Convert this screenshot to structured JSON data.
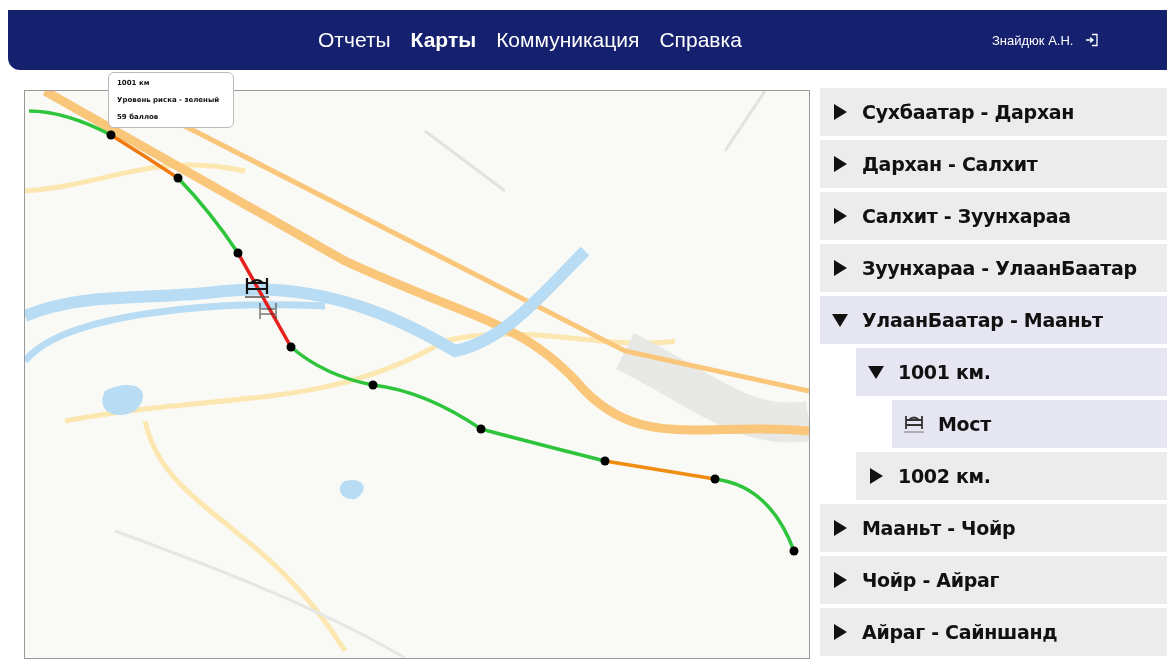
{
  "nav": {
    "items": [
      {
        "label": "Отчеты",
        "selected": false
      },
      {
        "label": "Карты",
        "selected": true
      },
      {
        "label": "Коммуникация",
        "selected": false
      },
      {
        "label": "Справка",
        "selected": false
      }
    ],
    "user": "Знайдюк А.Н."
  },
  "map": {
    "tooltip": [
      "1001 км",
      "Уровень риска - зеленый",
      "59 баллов"
    ],
    "segments": [
      {
        "color": "#2ec43c"
      },
      {
        "color": "#f07a10"
      },
      {
        "color": "#2ec43c"
      },
      {
        "color": "#e8201c"
      },
      {
        "color": "#2ec43c"
      },
      {
        "color": "#2ec43c"
      },
      {
        "color": "#2ec43c"
      },
      {
        "color": "#f08c10"
      },
      {
        "color": "#2ec43c"
      }
    ]
  },
  "tree": [
    {
      "label": "Сухбаатар - Дархан",
      "expanded": false
    },
    {
      "label": "Дархан - Салхит",
      "expanded": false
    },
    {
      "label": "Салхит - Зуунхараа",
      "expanded": false
    },
    {
      "label": "Зуунхараа - УлаанБаатар",
      "expanded": false
    },
    {
      "label": "УлаанБаатар - Мааньт",
      "expanded": true,
      "children": [
        {
          "label": "1001 км.",
          "expanded": true,
          "children": [
            {
              "label": "Мост",
              "kind": "bridge",
              "selected": true
            }
          ]
        },
        {
          "label": "1002 км.",
          "expanded": false
        }
      ]
    },
    {
      "label": "Мааньт - Чойр",
      "expanded": false
    },
    {
      "label": "Чойр - Айраг",
      "expanded": false
    },
    {
      "label": "Айраг - Сайншанд",
      "expanded": false
    }
  ]
}
